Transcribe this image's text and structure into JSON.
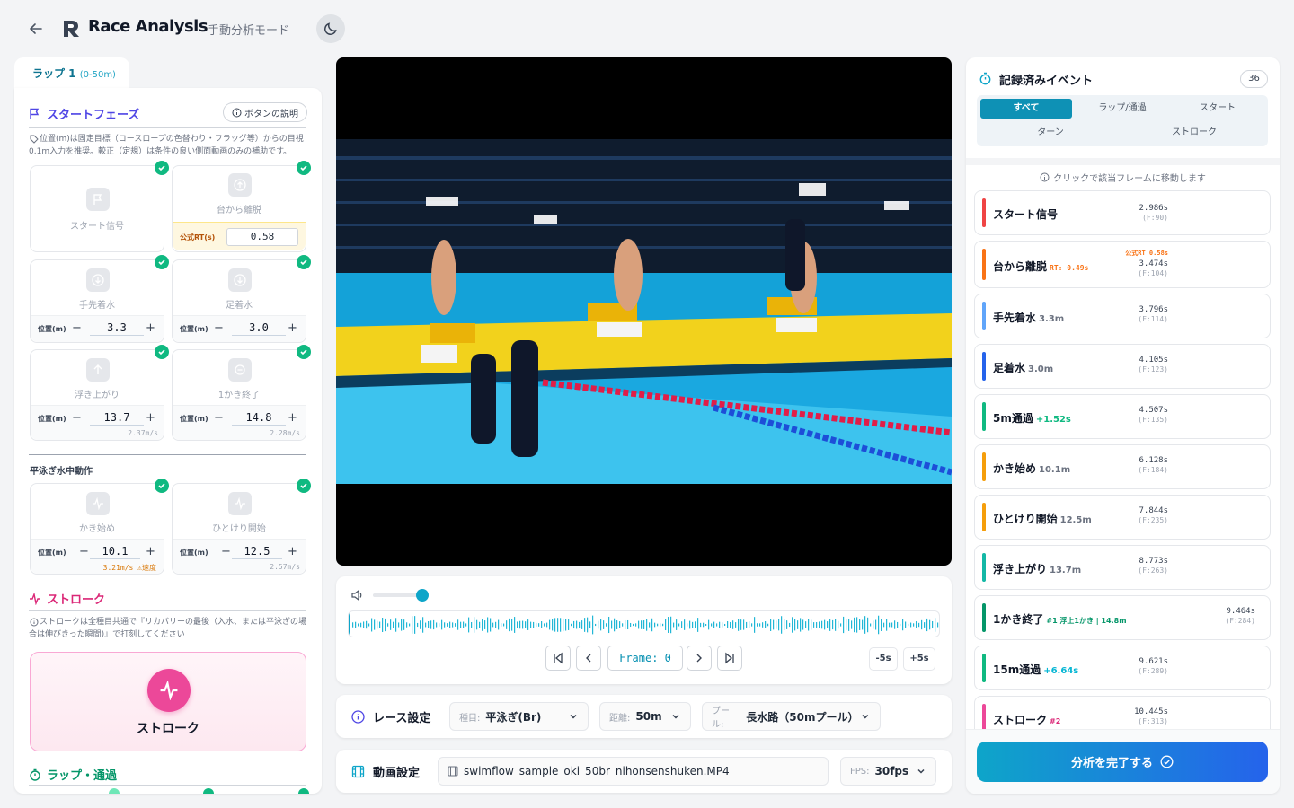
{
  "header": {
    "title": "Race Analysis",
    "mode": "手動分析モード"
  },
  "left": {
    "lap_tab": {
      "label": "ラップ 1",
      "range": "(0-50m)"
    },
    "start_phase": {
      "title": "スタートフェーズ",
      "help_button": "ボタンの説明",
      "note": "位置(m)は固定目標（コースロープの色替わり・フラッグ等）からの目視0.1m入力を推奨。較正（定規）は条件の良い側面動画のみの補助です。",
      "cards": {
        "start_signal": {
          "label": "スタート信号"
        },
        "leave_block": {
          "label": "台から離脱",
          "rt_label": "公式RT(s)",
          "rt_value": "0.58"
        },
        "hand_entry": {
          "label": "手先着水",
          "pos_label": "位置(m)",
          "value": "3.3"
        },
        "foot_entry": {
          "label": "足着水",
          "pos_label": "位置(m)",
          "value": "3.0"
        },
        "surface": {
          "label": "浮き上がり",
          "pos_label": "位置(m)",
          "value": "13.7",
          "speed": "2.37m/s"
        },
        "first_stroke_end": {
          "label": "1かき終了",
          "pos_label": "位置(m)",
          "value": "14.8",
          "speed": "2.28m/s"
        }
      }
    },
    "underwater": {
      "title": "平泳ぎ水中動作",
      "cards": {
        "pull_start": {
          "label": "かき始め",
          "pos_label": "位置(m)",
          "value": "10.1",
          "speed": "3.21m/s",
          "warn": "⚠速度"
        },
        "kick_start": {
          "label": "ひとけり開始",
          "pos_label": "位置(m)",
          "value": "12.5",
          "speed": "2.57m/s"
        }
      }
    },
    "stroke": {
      "title": "ストローク",
      "note": "ストロークは全種目共通で『リカバリーの最後（入水、または平泳ぎの場合は伸びきった瞬間)』で打刻してください",
      "button": "ストローク"
    },
    "lap_pass": {
      "title": "ラップ・通過"
    }
  },
  "player": {
    "frame_label": "Frame: 0",
    "volume": 0.5,
    "skip_back": "-5s",
    "skip_forward": "+5s"
  },
  "race_settings": {
    "title": "レース設定",
    "event_key": "種目:",
    "event_value": "平泳ぎ(Br)",
    "distance_key": "距離:",
    "distance_value": "50m",
    "pool_key": "プール:",
    "pool_value": "長水路（50mプール）"
  },
  "video_settings": {
    "title": "動画設定",
    "file": "swimflow_sample_oki_50br_nihonsenshuken.MP4",
    "fps_key": "FPS:",
    "fps_value": "30fps"
  },
  "events_panel": {
    "title": "記録済みイベント",
    "count": "36",
    "filters": [
      "すべて",
      "ラップ/通過",
      "スタート",
      "ターン",
      "ストローク"
    ],
    "hint": "クリックで該当フレームに移動します",
    "finish_button": "分析を完了する",
    "events": [
      {
        "name": "スタート信号",
        "extra": "",
        "time": "2.986s",
        "frame": "(F:90)",
        "color": "#ef4444"
      },
      {
        "name": "台から離脱",
        "extra": "RT: 0.49s",
        "official": "公式RT 0.58s",
        "time": "3.474s",
        "frame": "(F:104)",
        "color": "#f97316"
      },
      {
        "name": "手先着水",
        "extra": "3.3m",
        "time": "3.796s",
        "frame": "(F:114)",
        "color": "#60a5fa"
      },
      {
        "name": "足着水",
        "extra": "3.0m",
        "time": "4.105s",
        "frame": "(F:123)",
        "color": "#2563eb"
      },
      {
        "name": "5m通過",
        "extra": "+1.52s",
        "time": "4.507s",
        "frame": "(F:135)",
        "color": "#10b981"
      },
      {
        "name": "かき始め",
        "extra": "10.1m",
        "time": "6.128s",
        "frame": "(F:184)",
        "color": "#f59e0b"
      },
      {
        "name": "ひとけり開始",
        "extra": "12.5m",
        "time": "7.844s",
        "frame": "(F:235)",
        "color": "#f59e0b"
      },
      {
        "name": "浮き上がり",
        "extra": "13.7m",
        "time": "8.773s",
        "frame": "(F:263)",
        "color": "#14b8a6"
      },
      {
        "name": "1かき終了",
        "extra": "#1 浮上1かき | 14.8m",
        "time": "9.464s",
        "frame": "(F:284)",
        "color": "#059669"
      },
      {
        "name": "15m通過",
        "extra": "+6.64s",
        "time": "9.621s",
        "frame": "(F:289)",
        "color": "#10b981"
      },
      {
        "name": "ストローク",
        "extra": "#2",
        "time": "10.445s",
        "frame": "(F:313)",
        "color": "#ec4899"
      }
    ]
  }
}
